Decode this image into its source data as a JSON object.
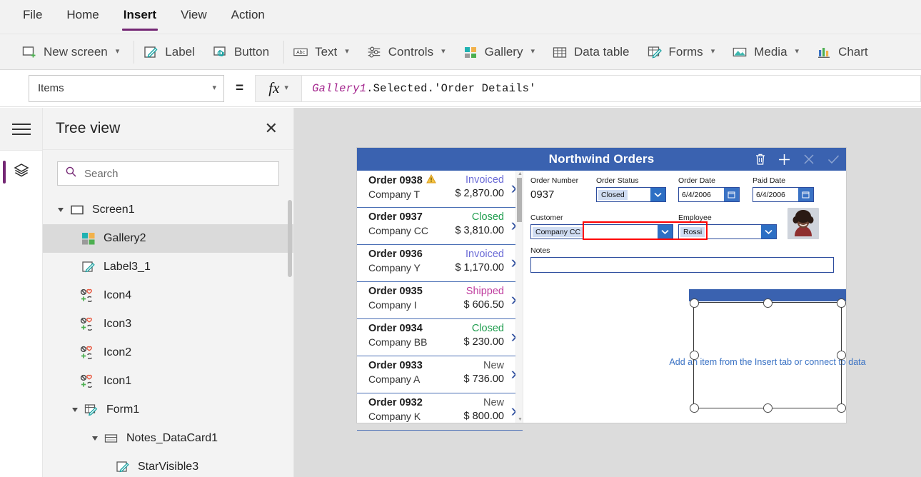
{
  "menu": {
    "items": [
      {
        "label": "File",
        "active": false
      },
      {
        "label": "Home",
        "active": false
      },
      {
        "label": "Insert",
        "active": true
      },
      {
        "label": "View",
        "active": false
      },
      {
        "label": "Action",
        "active": false
      }
    ]
  },
  "ribbon": {
    "items": [
      {
        "label": "New screen",
        "icon": "new-screen-icon",
        "dropdown": true
      },
      {
        "label": "Label",
        "icon": "label-icon",
        "dropdown": false
      },
      {
        "label": "Button",
        "icon": "button-icon",
        "dropdown": false
      },
      {
        "label": "Text",
        "icon": "text-icon",
        "dropdown": true
      },
      {
        "label": "Controls",
        "icon": "controls-icon",
        "dropdown": true
      },
      {
        "label": "Gallery",
        "icon": "gallery-icon",
        "dropdown": true
      },
      {
        "label": "Data table",
        "icon": "data-table-icon",
        "dropdown": false
      },
      {
        "label": "Forms",
        "icon": "forms-icon",
        "dropdown": true
      },
      {
        "label": "Media",
        "icon": "media-icon",
        "dropdown": true
      },
      {
        "label": "Chart",
        "icon": "chart-icon",
        "dropdown": false
      }
    ]
  },
  "formula_bar": {
    "property": "Items",
    "equals": "=",
    "fx_label": "fx",
    "formula_control": "Gallery1",
    "formula_rest": ".Selected.'Order Details'"
  },
  "tree_view": {
    "title": "Tree view",
    "search_placeholder": "Search",
    "search_value": "",
    "items": [
      {
        "label": "Screen1",
        "indent": 0,
        "icon": "screen-icon",
        "expander": true,
        "selected": false
      },
      {
        "label": "Gallery2",
        "indent": 1,
        "icon": "gallery-icon",
        "expander": false,
        "selected": true
      },
      {
        "label": "Label3_1",
        "indent": 1,
        "icon": "label-icon",
        "expander": false,
        "selected": false
      },
      {
        "label": "Icon4",
        "indent": 1,
        "icon": "icon-set-icon",
        "expander": false,
        "selected": false
      },
      {
        "label": "Icon3",
        "indent": 1,
        "icon": "icon-set-icon",
        "expander": false,
        "selected": false
      },
      {
        "label": "Icon2",
        "indent": 1,
        "icon": "icon-set-icon",
        "expander": false,
        "selected": false
      },
      {
        "label": "Icon1",
        "indent": 1,
        "icon": "icon-set-icon",
        "expander": false,
        "selected": false
      },
      {
        "label": "Form1",
        "indent": 1,
        "icon": "form-icon",
        "expander": true,
        "selected": false
      },
      {
        "label": "Notes_DataCard1",
        "indent": 2,
        "icon": "datacard-icon",
        "expander": true,
        "selected": false
      },
      {
        "label": "StarVisible3",
        "indent": 3,
        "icon": "label-icon",
        "expander": false,
        "selected": false
      }
    ]
  },
  "app": {
    "title": "Northwind Orders",
    "header_icons": [
      {
        "name": "delete-icon",
        "dimmed": false
      },
      {
        "name": "add-icon",
        "dimmed": false
      },
      {
        "name": "cancel-icon",
        "dimmed": true
      },
      {
        "name": "save-icon",
        "dimmed": true
      }
    ],
    "gallery": {
      "items": [
        {
          "order": "Order 0938",
          "company": "Company T",
          "status": "Invoiced",
          "status_key": "invoiced",
          "amount": "$ 2,870.00",
          "warning": true
        },
        {
          "order": "Order 0937",
          "company": "Company CC",
          "status": "Closed",
          "status_key": "closed",
          "amount": "$ 3,810.00",
          "warning": false
        },
        {
          "order": "Order 0936",
          "company": "Company Y",
          "status": "Invoiced",
          "status_key": "invoiced",
          "amount": "$ 1,170.00",
          "warning": false
        },
        {
          "order": "Order 0935",
          "company": "Company I",
          "status": "Shipped",
          "status_key": "shipped",
          "amount": "$ 606.50",
          "warning": false
        },
        {
          "order": "Order 0934",
          "company": "Company BB",
          "status": "Closed",
          "status_key": "closed",
          "amount": "$ 230.00",
          "warning": false
        },
        {
          "order": "Order 0933",
          "company": "Company A",
          "status": "New",
          "status_key": "new",
          "amount": "$ 736.00",
          "warning": false
        },
        {
          "order": "Order 0932",
          "company": "Company K",
          "status": "New",
          "status_key": "new",
          "amount": "$ 800.00",
          "warning": false
        }
      ]
    },
    "form": {
      "order_number_label": "Order Number",
      "order_number_value": "0937",
      "order_status_label": "Order Status",
      "order_status_value": "Closed",
      "order_date_label": "Order Date",
      "order_date_value": "6/4/2006",
      "paid_date_label": "Paid Date",
      "paid_date_value": "6/4/2006",
      "customer_label": "Customer",
      "customer_value": "Company CC",
      "employee_label": "Employee",
      "employee_value": "Rossi",
      "notes_label": "Notes",
      "notes_value": ""
    },
    "empty_gallery_placeholder": "Add an item from the Insert tab or connect to data"
  },
  "colors": {
    "accent_purple": "#742774",
    "app_header_blue": "#3a62b0",
    "status_invoiced": "#6b6bd6",
    "status_closed": "#1f9d4e",
    "status_shipped": "#bf3c9e",
    "status_new": "#555555",
    "annotation_red": "#ff0000",
    "formula_token": "#a4268e"
  }
}
